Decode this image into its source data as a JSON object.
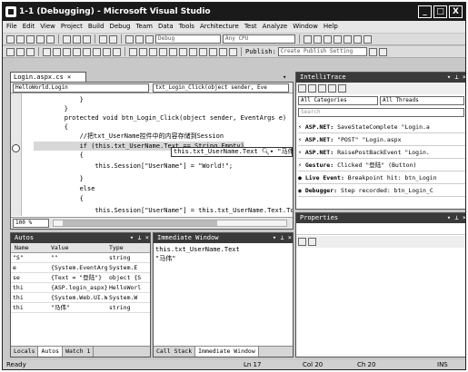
{
  "window": {
    "title": "1-1 (Debugging) - Microsoft Visual Studio",
    "min": "_",
    "max": "□",
    "close": "X"
  },
  "menu": [
    "File",
    "Edit",
    "View",
    "Project",
    "Build",
    "Debug",
    "Team",
    "Data",
    "Tools",
    "Architecture",
    "Test",
    "Analyze",
    "Window",
    "Help"
  ],
  "toolbar": {
    "config_combo": "Debug",
    "platform_combo": "Any CPU",
    "publish_label": "Publish:",
    "publish_combo": "Create Publish Setting"
  },
  "editor": {
    "tab_label": "Login.aspx.cs ×",
    "class_combo": "HelloWorld.Login",
    "method_combo": "txt_Login_Click(object sender, Eve",
    "zoom": "100 %",
    "lines": [
      "            }",
      "        }",
      "        protected void btn_Login_Click(object sender, EventArgs e)",
      "        {",
      "            //把txt_UserName控件中的内容存储到Session",
      "            if (this.txt_UserName.Text == String.Empty)",
      "            {",
      "                this.Session[\"UserName\"] = \"World!\";",
      "            }",
      "            else",
      "            {",
      "                this.Session[\"UserName\"] = this.txt_UserName.Text.ToS"
    ],
    "tooltip_expr": "this.txt_UserName.Text",
    "tooltip_value": "\"马伟\""
  },
  "intellitrace": {
    "title": "IntelliTrace",
    "categories_combo": "All Categories",
    "threads_combo": "All Threads",
    "search_placeholder": "Search",
    "events": [
      {
        "prefix": "ASP.NET:",
        "text": "SaveStateComplete \"Login.a"
      },
      {
        "prefix": "ASP.NET:",
        "text": "\"POST\" \"Login.aspx"
      },
      {
        "prefix": "ASP.NET:",
        "text": "RaisePostBackEvent \"Login."
      },
      {
        "prefix": "Gesture:",
        "text": "Clicked \"登陆\" (Button)"
      },
      {
        "prefix": "Live Event:",
        "text": "Breakpoint hit: btn_Login"
      },
      {
        "prefix": "Debugger:",
        "text": "Step recorded: btn_Login_C"
      }
    ]
  },
  "properties": {
    "title": "Properties"
  },
  "autos": {
    "title": "Autos",
    "columns": [
      "Name",
      "Value",
      "Type"
    ],
    "rows": [
      {
        "name": "\"S\"",
        "value": "\"\"",
        "type": "string"
      },
      {
        "name": "e",
        "value": "{System.EventArgs}",
        "type": "System.E"
      },
      {
        "name": "se",
        "value": "{Text = \"登陆\"}",
        "type": "object {S"
      },
      {
        "name": "thi",
        "value": "{ASP.login_aspx}",
        "type": "HelloWorl"
      },
      {
        "name": "thi",
        "value": "{System.Web.UI.W",
        "type": "System.W"
      },
      {
        "name": "thi",
        "value": "\"马伟\"",
        "type": "string"
      }
    ],
    "tabs": [
      "Locals",
      "Autos",
      "Watch 1"
    ]
  },
  "immediate": {
    "title": "Immediate Window",
    "lines": [
      "this.txt_UserName.Text",
      "\"马伟\""
    ],
    "tabs": [
      "Call Stack",
      "Immediate Window"
    ]
  },
  "statusbar": {
    "ready": "Ready",
    "ln": "Ln 17",
    "col": "Col 20",
    "ch": "Ch 20",
    "ins": "INS"
  }
}
